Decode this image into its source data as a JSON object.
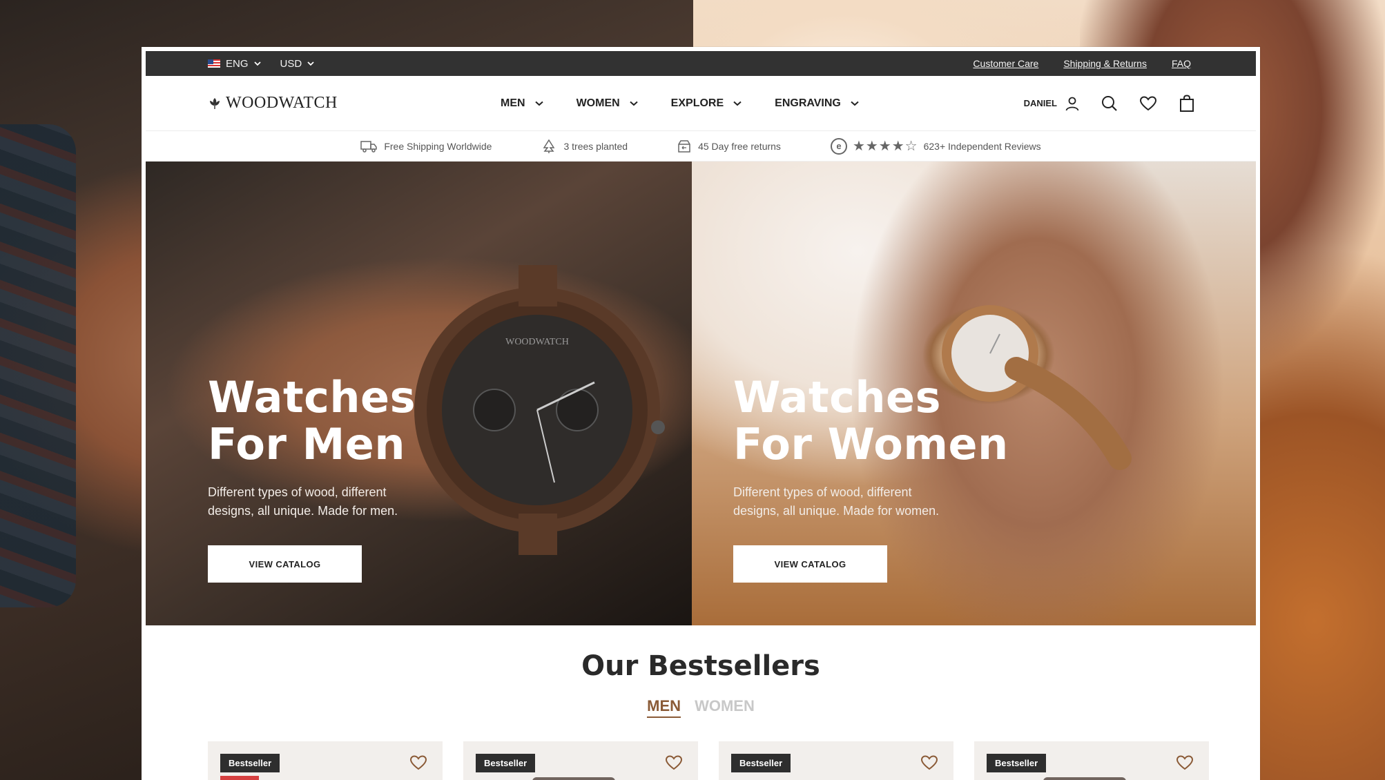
{
  "top_bar": {
    "language": "ENG",
    "currency": "USD",
    "links": [
      "Customer Care",
      "Shipping & Returns",
      "FAQ"
    ]
  },
  "header": {
    "logo": "WOODWATCH",
    "nav": [
      "MEN",
      "WOMEN",
      "EXPLORE",
      "ENGRAVING"
    ],
    "account_name": "DANIEL"
  },
  "usp": {
    "shipping": "Free Shipping Worldwide",
    "trees": "3 trees planted",
    "returns": "45 Day free returns",
    "reviews": "623+ Independent Reviews",
    "rating_stars": 4.5
  },
  "hero": {
    "men": {
      "title_line1": "Watches",
      "title_line2": "For Men",
      "description": "Different types of wood, different designs, all unique. Made for men.",
      "cta": "VIEW CATALOG"
    },
    "women": {
      "title_line1": "Watches",
      "title_line2": "For Women",
      "description": "Different types of wood, different designs, all unique. Made for women.",
      "cta": "VIEW CATALOG"
    }
  },
  "bestsellers": {
    "title": "Our Bestsellers",
    "tabs": [
      "MEN",
      "WOMEN"
    ],
    "active_tab": "MEN",
    "cards": [
      {
        "badge": "Bestseller"
      },
      {
        "badge": "Bestseller"
      },
      {
        "badge": "Bestseller"
      },
      {
        "badge": "Bestseller"
      }
    ]
  },
  "colors": {
    "accent": "#8a5a36",
    "topbar": "#323232",
    "sale": "#d64040"
  }
}
